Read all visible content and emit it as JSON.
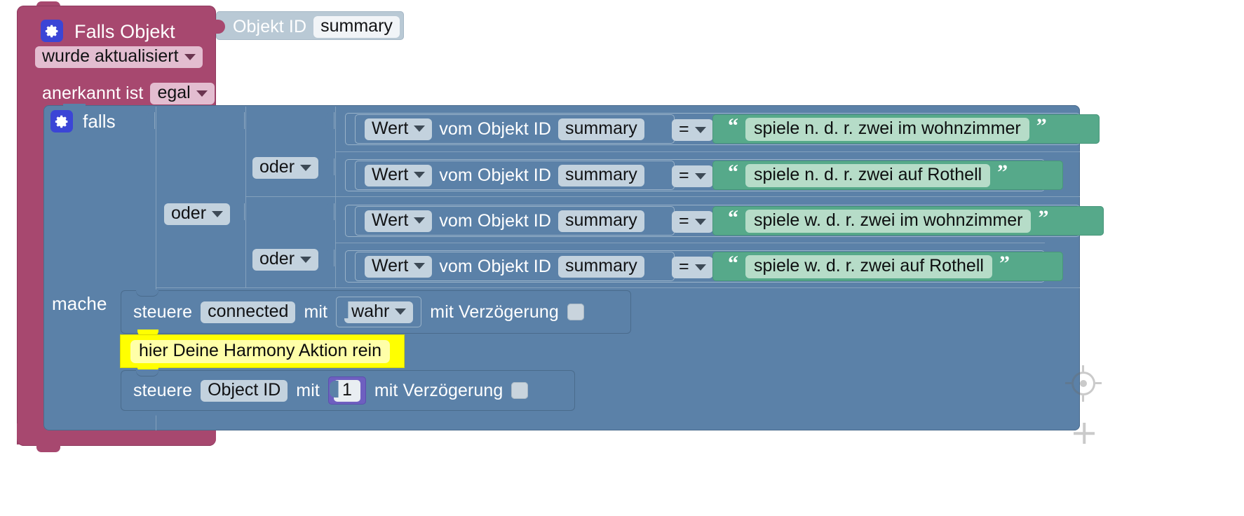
{
  "app": {
    "kind": "blockly-visual-script-editor",
    "language": "de"
  },
  "colors": {
    "event_block": "#a7486f",
    "value_block": "#b9c9d5",
    "logic_block": "#5b81a8",
    "text_block": "#56a98a",
    "text_field": "#b6dcc8",
    "number_block": "#6e5fc0",
    "comment_block": "#ffff00",
    "gear_icon": "#3b45d6",
    "field_background": "#e9eef2",
    "workspace_background": "#ffffff",
    "grid_dot": "#d4d4d4"
  },
  "event_block": {
    "gear_icon": "gear-icon",
    "title": "Falls Objekt",
    "trigger_dropdown": "wurde aktualisiert",
    "ack_label": "anerkannt ist",
    "ack_dropdown": "egal",
    "object_id": {
      "label": "Objekt ID",
      "value": "summary"
    }
  },
  "if_block": {
    "gear_icon": "gear-icon",
    "if_label": "falls",
    "do_label": "mache",
    "or_outer": "oder",
    "or_inner_top": "oder",
    "or_inner_bottom": "oder",
    "conditions": [
      {
        "getter_dropdown": "Wert",
        "getter_label": "vom Objekt ID",
        "object_id": "summary",
        "operator": "=",
        "value": "spiele n. d. r. zwei im wohnzimmer"
      },
      {
        "getter_dropdown": "Wert",
        "getter_label": "vom Objekt ID",
        "object_id": "summary",
        "operator": "=",
        "value": "spiele n. d. r. zwei auf Rothell"
      },
      {
        "getter_dropdown": "Wert",
        "getter_label": "vom Objekt ID",
        "object_id": "summary",
        "operator": "=",
        "value": "spiele w. d. r. zwei im wohnzimmer"
      },
      {
        "getter_dropdown": "Wert",
        "getter_label": "vom Objekt ID",
        "object_id": "summary",
        "operator": "=",
        "value": "spiele w. d. r. zwei auf Rothell"
      }
    ]
  },
  "statements": [
    {
      "verb": "steuere",
      "target": "connected",
      "with_label": "mit",
      "value_dropdown": "wahr",
      "delay_label": "mit Verzögerung",
      "delay_checked": false
    },
    {
      "verb": "steuere",
      "target": "Object ID",
      "with_label": "mit",
      "value_number": "1",
      "delay_label": "mit Verzögerung",
      "delay_checked": false
    }
  ],
  "comment": {
    "text": "hier Deine Harmony Aktion rein"
  },
  "controls": {
    "center_icon": "center-target-icon",
    "zoom_in_icon": "zoom-in-icon"
  }
}
